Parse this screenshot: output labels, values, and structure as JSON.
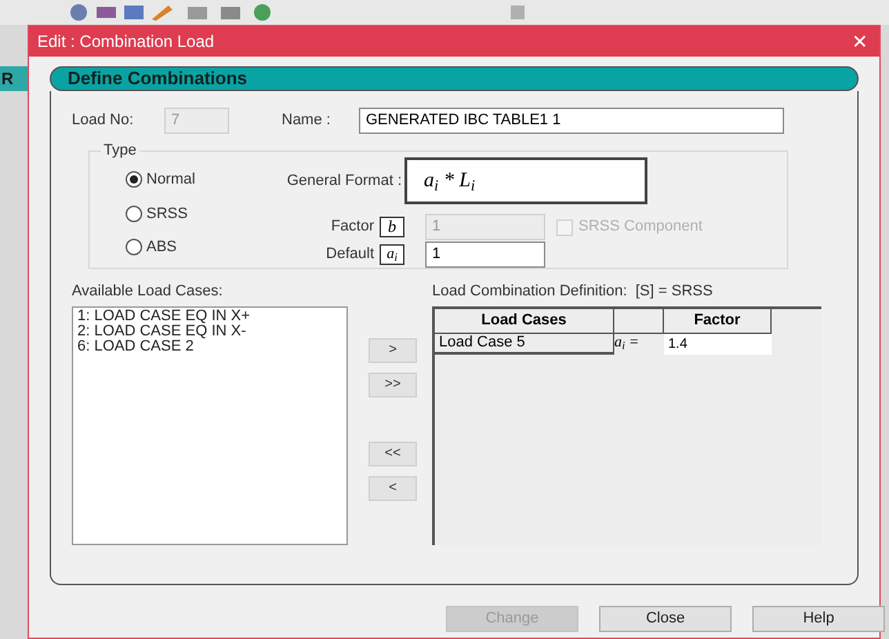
{
  "background": {
    "fragment": "R"
  },
  "window": {
    "title": "Edit : Combination Load",
    "close": "✕"
  },
  "header": "Define Combinations",
  "load_no": {
    "label": "Load No:",
    "value": "7",
    "disabled": true
  },
  "name": {
    "label": "Name :",
    "value": "GENERATED IBC TABLE1 1"
  },
  "type": {
    "label": "Type",
    "options": [
      {
        "label": "Normal",
        "selected": true
      },
      {
        "label": "SRSS",
        "selected": false
      },
      {
        "label": "ABS",
        "selected": false
      }
    ]
  },
  "general_format": {
    "label": "General Format :",
    "formula": "a$_{i}$ * L$_{i}$"
  },
  "factor": {
    "label": "Factor",
    "symbol": "b",
    "value": "1",
    "disabled": true
  },
  "srss_component": {
    "label": "SRSS Component",
    "checked": false,
    "disabled": true
  },
  "default": {
    "label": "Default",
    "symbol": "a$_{i}$",
    "value": "1"
  },
  "available": {
    "label": "Available Load Cases:",
    "items": [
      "1: LOAD CASE EQ IN X+",
      "2: LOAD CASE EQ IN X-",
      "6: LOAD CASE 2"
    ]
  },
  "transfer_buttons": [
    ">",
    ">>",
    "<<",
    "<"
  ],
  "definition": {
    "label": "Load Combination Definition:  [S] = SRSS",
    "columns": [
      "Load Cases",
      "Factor"
    ],
    "rows": [
      {
        "load_case": "Load Case 5",
        "symbol": "a$_{i}$ =",
        "factor": "1.4"
      }
    ]
  },
  "buttons": [
    {
      "label": "Change",
      "disabled": true
    },
    {
      "label": "Close",
      "disabled": false
    },
    {
      "label": "Help",
      "disabled": false
    }
  ]
}
